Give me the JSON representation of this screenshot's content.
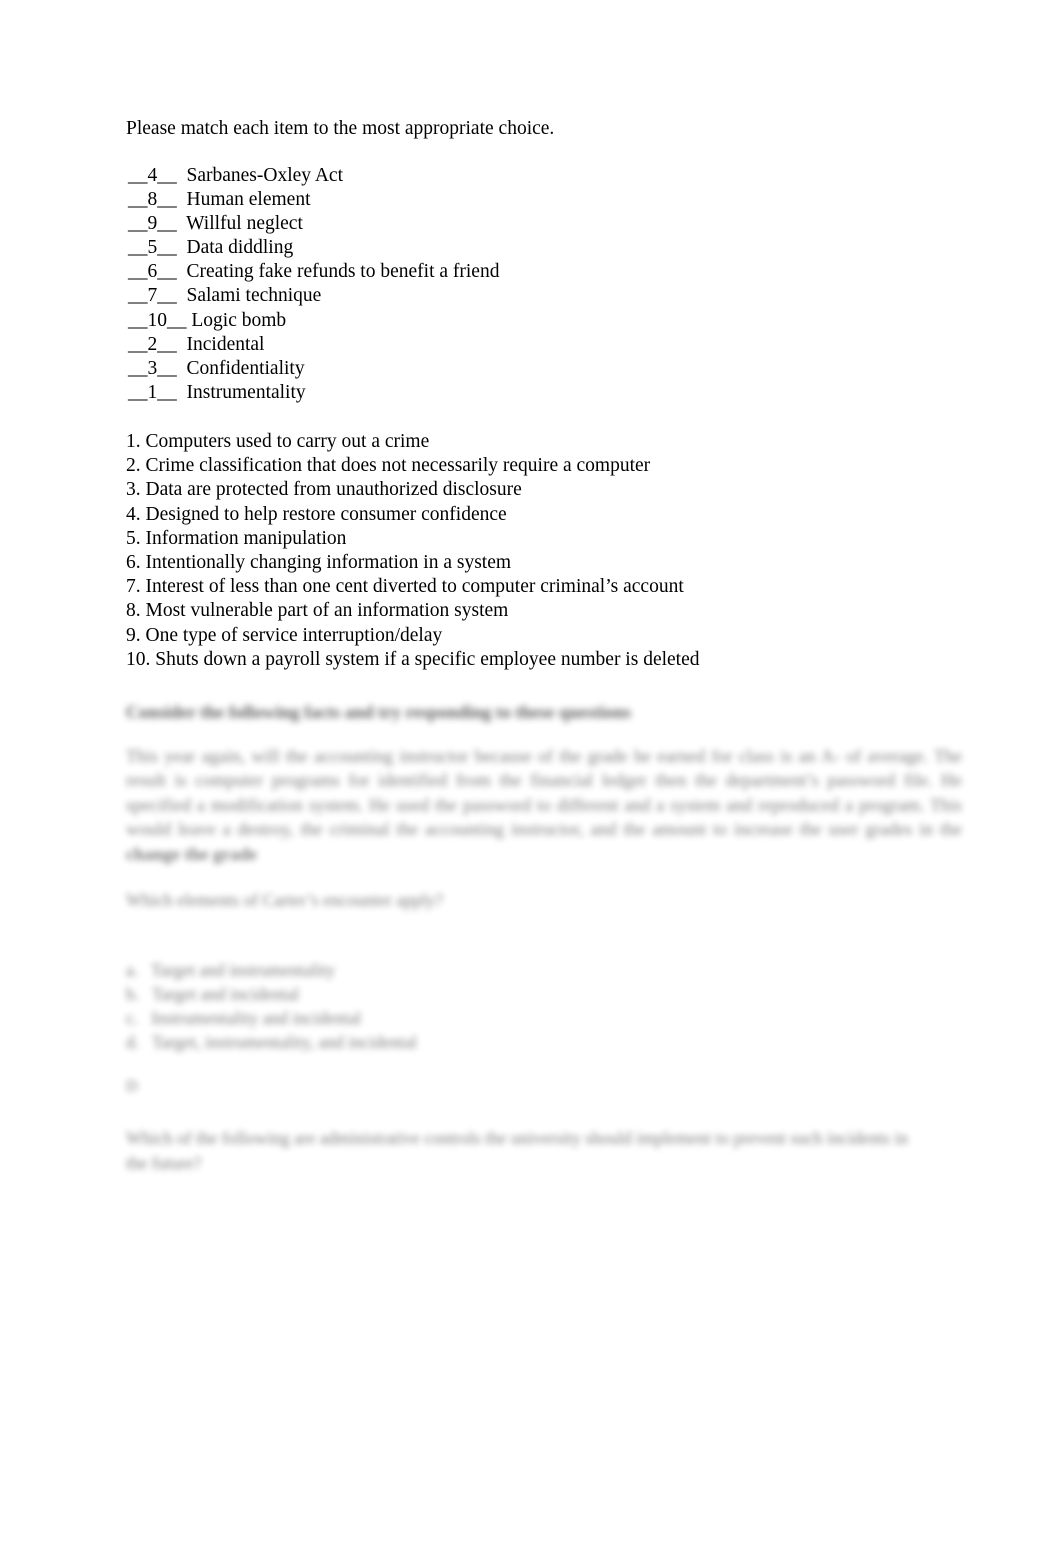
{
  "document": {
    "instruction": "Please match each item to the most appropriate choice.",
    "matching_items": [
      {
        "blank": "__4__",
        "gap": "  ",
        "label": "Sarbanes-Oxley Act"
      },
      {
        "blank": "__8__",
        "gap": "  ",
        "label": "Human element"
      },
      {
        "blank": "__9__",
        "gap": "  ",
        "label": "Willful neglect"
      },
      {
        "blank": "__5__",
        "gap": "  ",
        "label": "Data diddling"
      },
      {
        "blank": "__6__",
        "gap": "  ",
        "label": "Creating fake refunds to benefit a friend"
      },
      {
        "blank": "__7__",
        "gap": "  ",
        "label": "Salami technique"
      },
      {
        "blank": "__10__",
        "gap": " ",
        "label": "Logic bomb"
      },
      {
        "blank": "__2__",
        "gap": "  ",
        "label": "Incidental"
      },
      {
        "blank": "__3__",
        "gap": "  ",
        "label": "Confidentiality"
      },
      {
        "blank": "__1__",
        "gap": "  ",
        "label": "Instrumentality"
      }
    ],
    "choices": [
      {
        "number": "1.",
        "text": "Computers used to carry out a crime"
      },
      {
        "number": "2.",
        "text": "Crime classification that does not necessarily require a computer"
      },
      {
        "number": "3.",
        "text": "Data are protected from unauthorized disclosure"
      },
      {
        "number": "4.",
        "text": "Designed to help restore consumer confidence"
      },
      {
        "number": "5.",
        "text": "Information manipulation"
      },
      {
        "number": "6.",
        "text": "Intentionally changing information in a system"
      },
      {
        "number": "7.",
        "text": "Interest of less than one cent diverted to computer criminal’s account"
      },
      {
        "number": "8.",
        "text": "Most vulnerable part of an information system"
      },
      {
        "number": "9.",
        "text": "One type of service interruption/delay"
      },
      {
        "number": "10.",
        "text": "Shuts down a payroll system if a specific employee number is deleted"
      }
    ],
    "obscured_section": {
      "heading": "Consider the following facts and try responding to these questions",
      "paragraph_body": "This year again, will the accounting instructor because of the grade he earned for class is an A- of average. The result is computer programs for identified from the financial ledger then the department’s password file. He specified a modification system. He used the password to different and a system and reproduced a program. This would leave a destroy, the criminal the accounting instructor, and the amount to increase the user grades in the ",
      "paragraph_bold_tail": "change the grade",
      "question": "Which elements of Carter’s encounter apply?",
      "options": [
        {
          "letter": "a.",
          "text": "Target and instrumentality"
        },
        {
          "letter": "b.",
          "text": "Target and incidental"
        },
        {
          "letter": "c.",
          "text": "Instrumentality and incidental"
        },
        {
          "letter": "d.",
          "text": "Target, instrumentality, and incidental"
        }
      ],
      "answer_marker": "D",
      "final_question": "Which of the following are administrative controls the university should implement to prevent such incidents in the future?"
    }
  }
}
